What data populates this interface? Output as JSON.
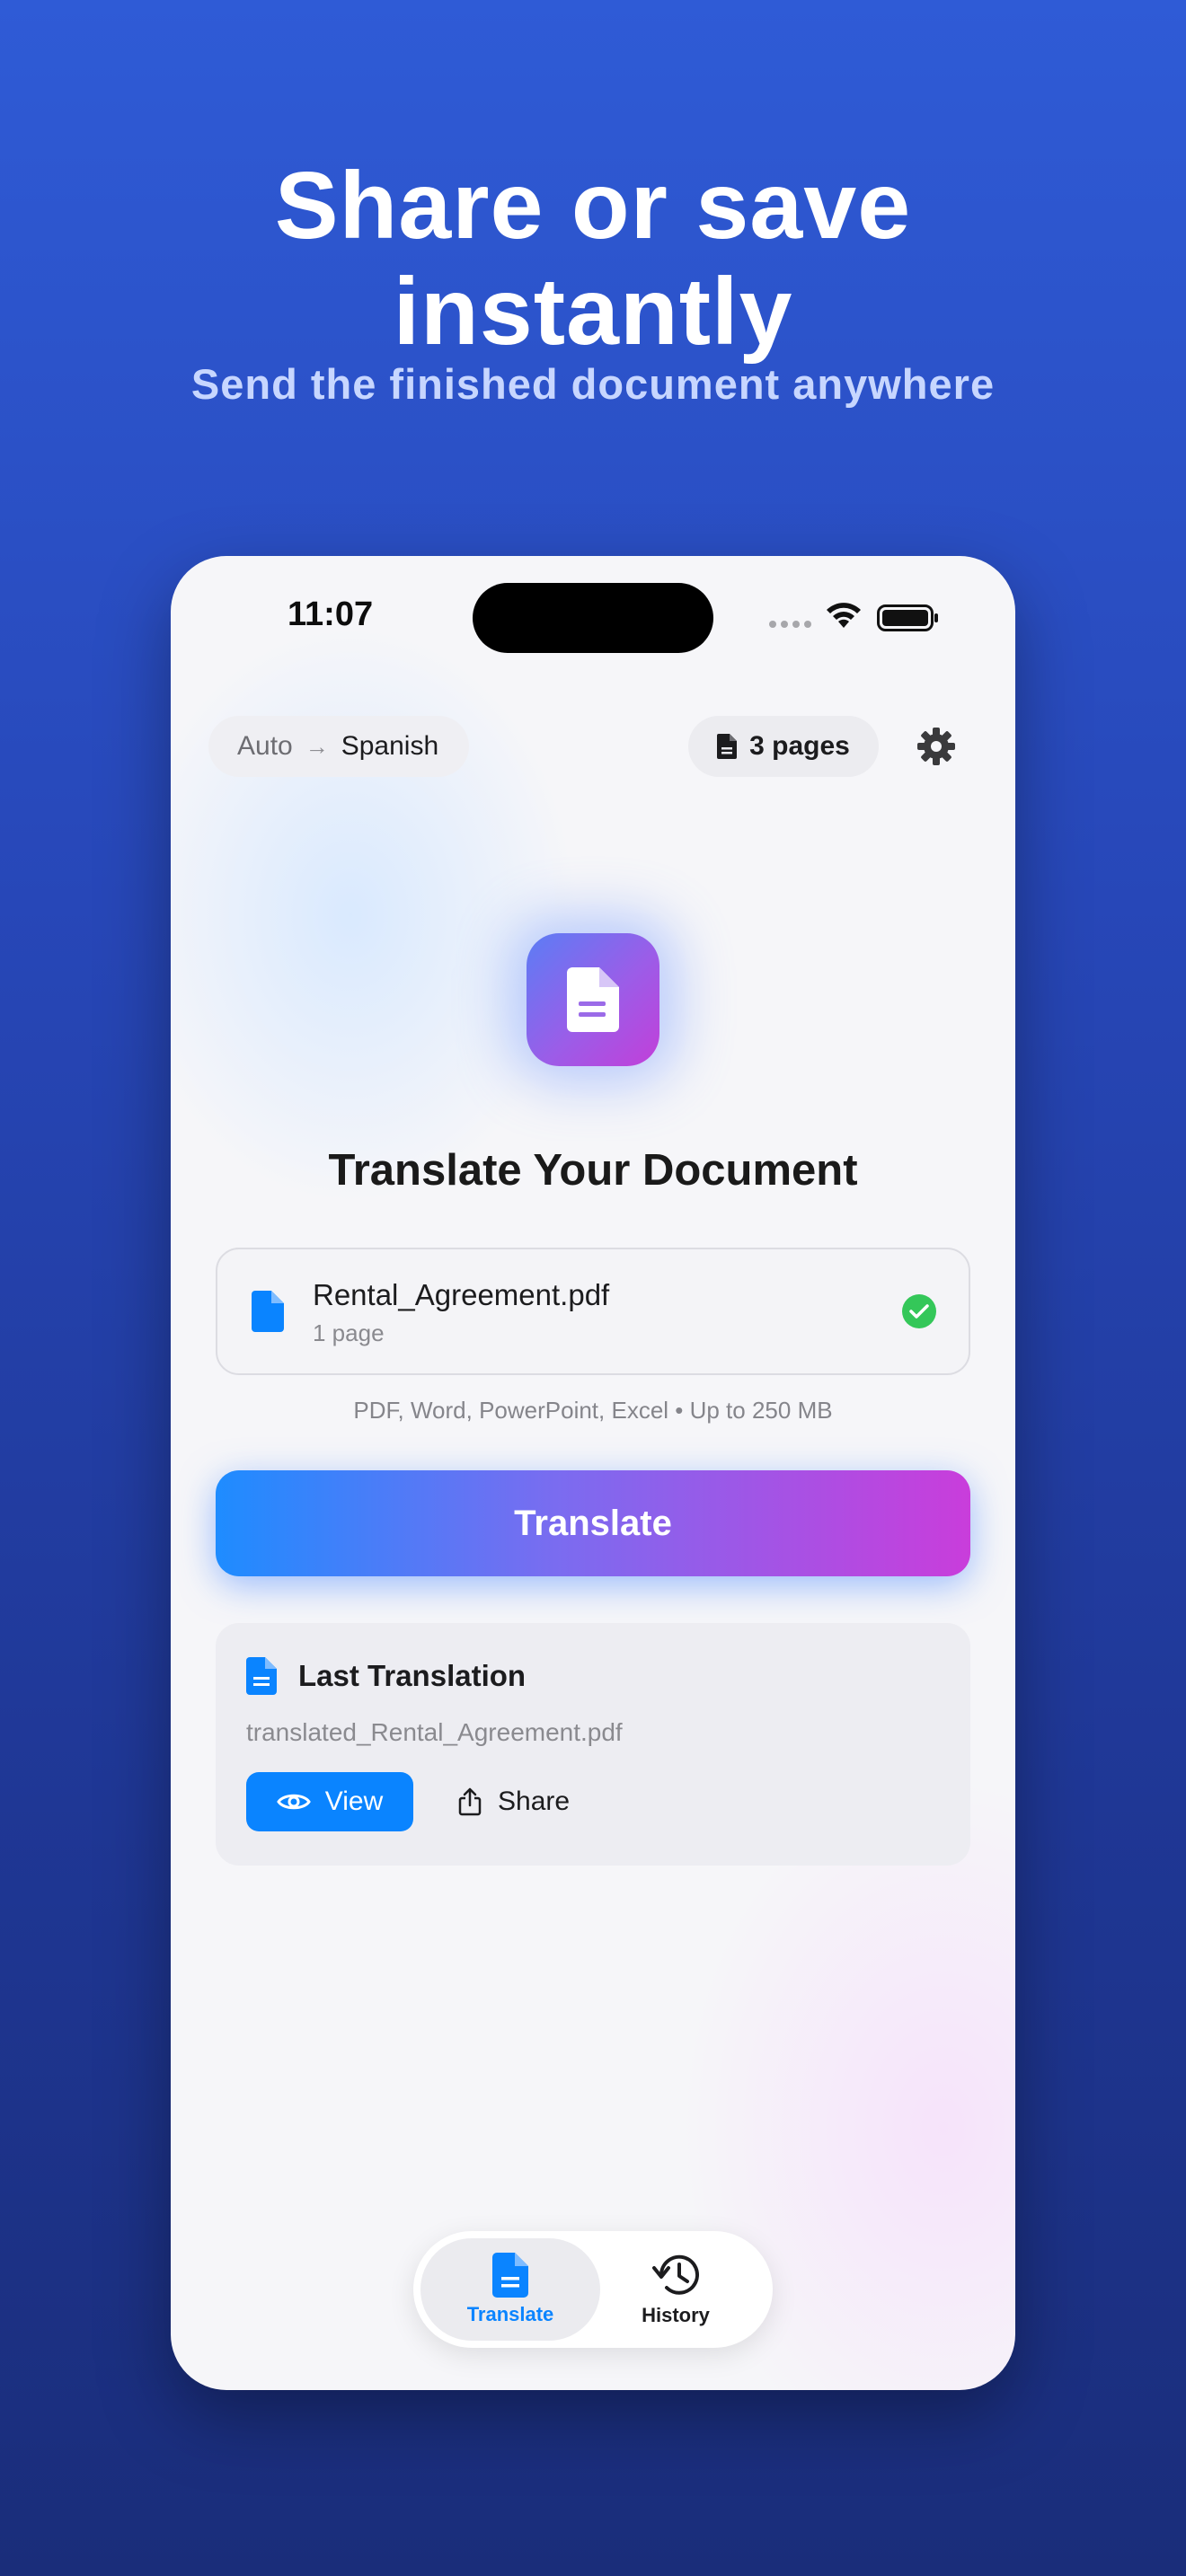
{
  "marketing": {
    "headline_line1": "Share or save",
    "headline_line2": "instantly",
    "subheadline": "Send the finished document anywhere"
  },
  "status_bar": {
    "time": "11:07"
  },
  "top_bar": {
    "source_language": "Auto",
    "arrow": "→",
    "target_language": "Spanish",
    "pages_label": "3 pages",
    "settings_icon": "gear-icon"
  },
  "main": {
    "hero_icon": "document-icon",
    "title": "Translate Your Document",
    "file": {
      "name": "Rental_Agreement.pdf",
      "pages": "1 page",
      "status_icon": "checkmark-circle-icon"
    },
    "formats_hint": "PDF, Word, PowerPoint, Excel • Up to 250 MB",
    "translate_button": "Translate"
  },
  "last_translation": {
    "title": "Last Translation",
    "file_name": "translated_Rental_Agreement.pdf",
    "view_label": "View",
    "share_label": "Share"
  },
  "tab_bar": {
    "tabs": [
      {
        "label": "Translate",
        "icon": "document-icon",
        "active": true
      },
      {
        "label": "History",
        "icon": "history-icon",
        "active": false
      }
    ]
  },
  "colors": {
    "accent": "#0a84ff",
    "success": "#34c759",
    "gradient_start": "#1e8cff",
    "gradient_end": "#c93ddb",
    "background_top": "#2f5bd6",
    "background_bottom": "#1a2d7a"
  }
}
